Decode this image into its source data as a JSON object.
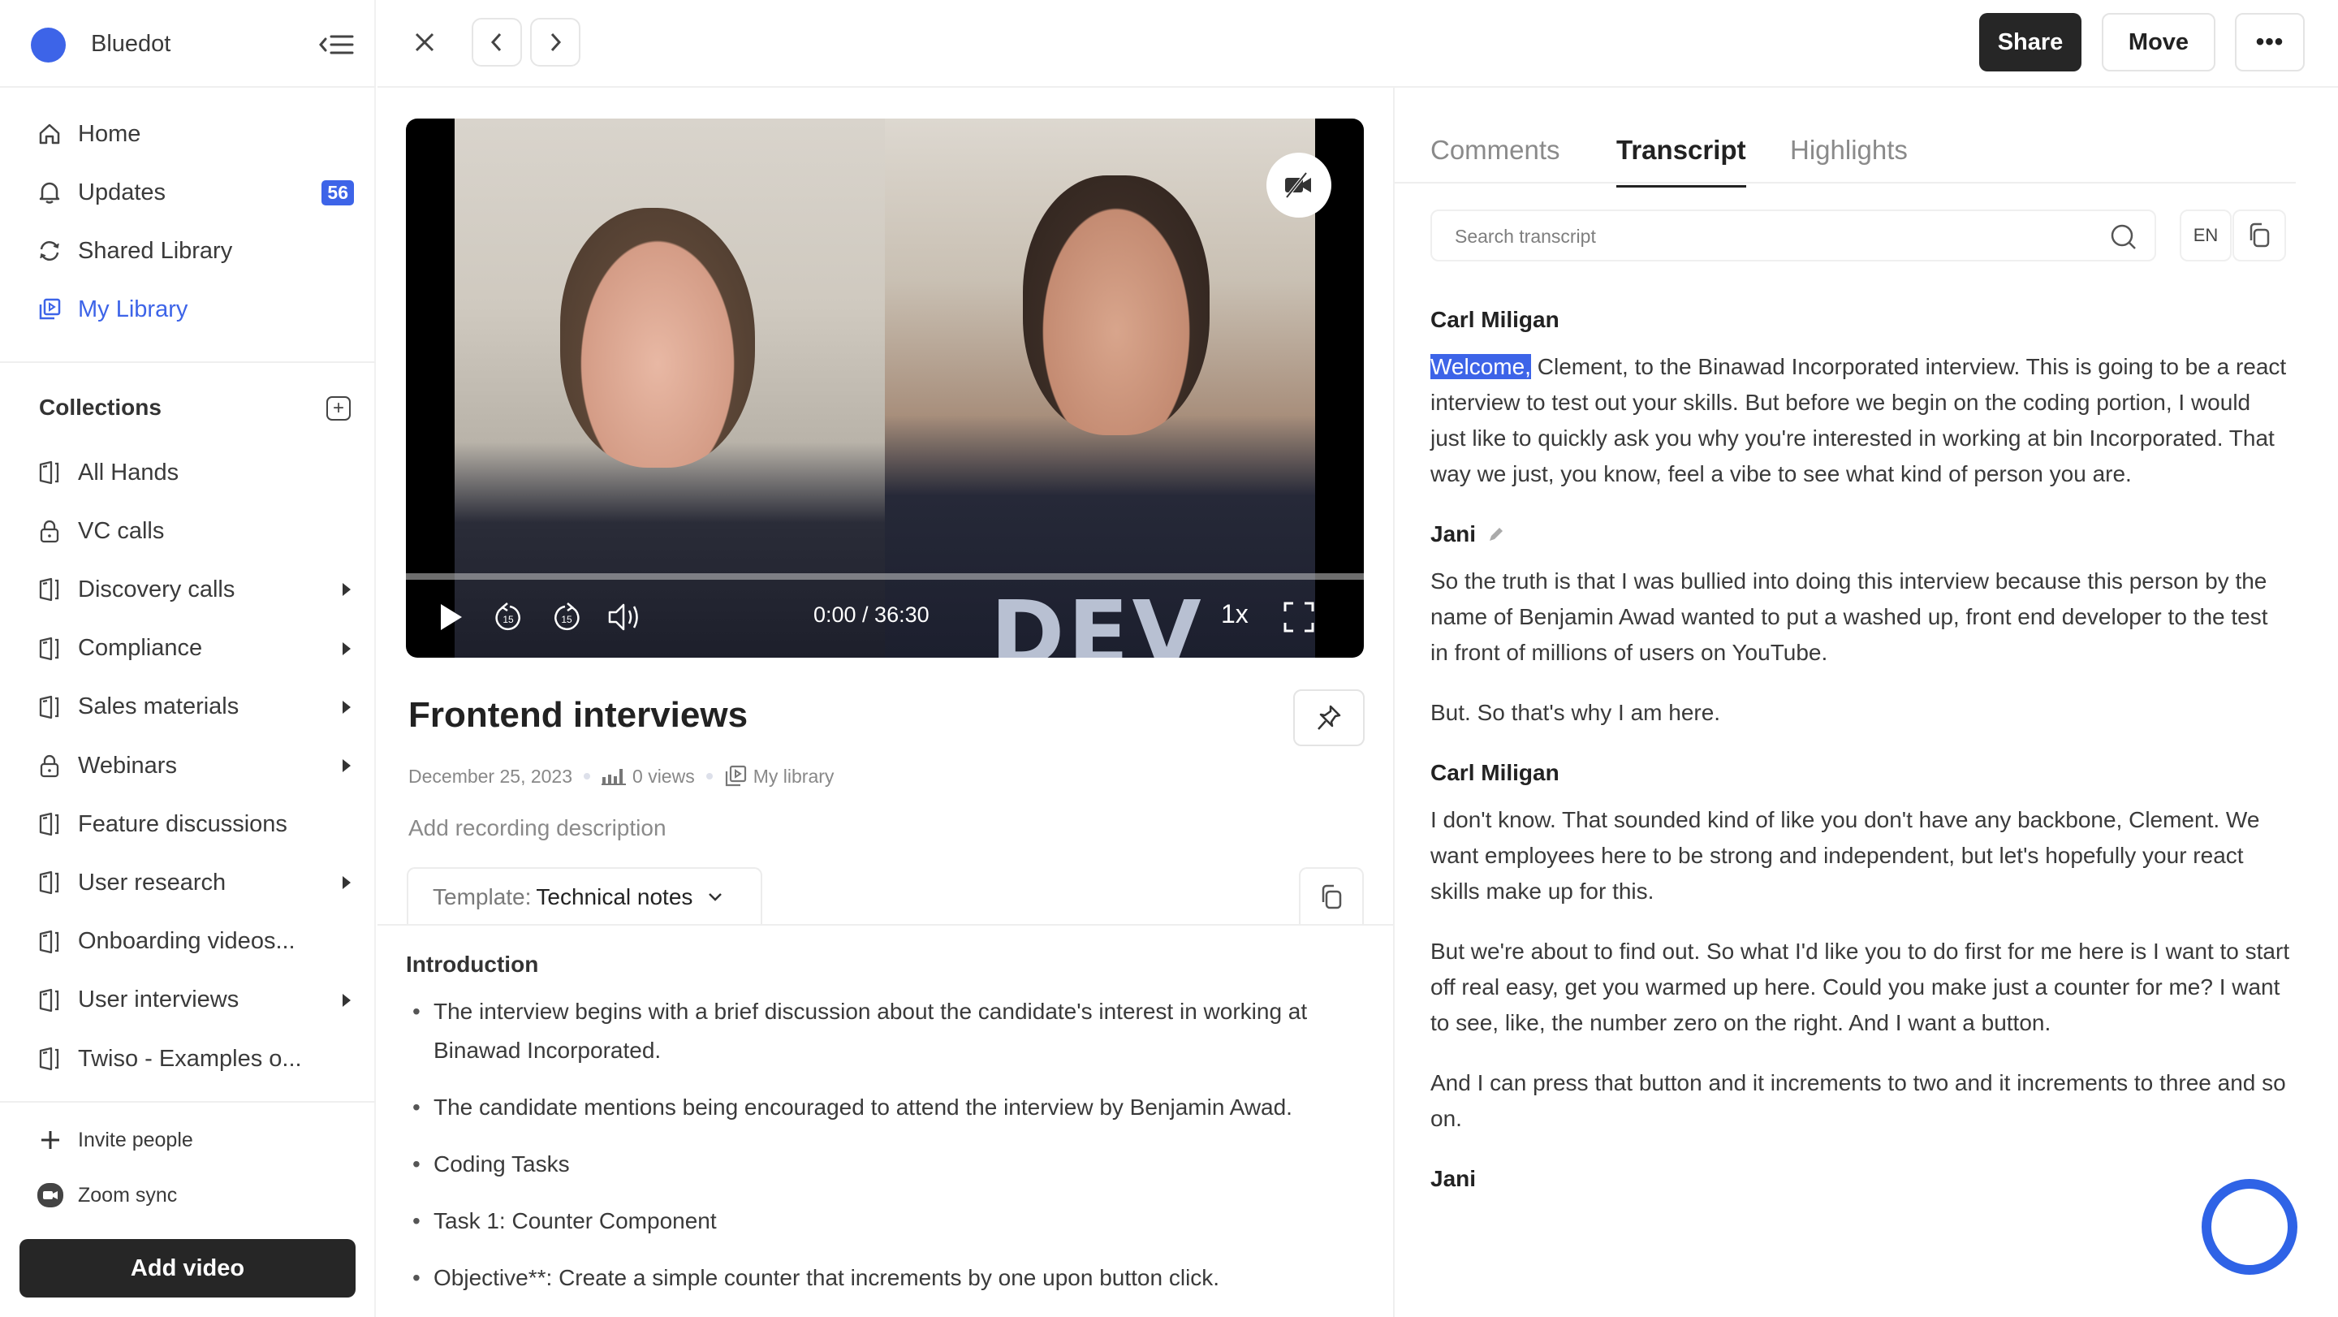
{
  "app": {
    "brand_name": "Bluedot",
    "accent_color": "#3d64e8"
  },
  "sidebar": {
    "nav": [
      {
        "label": "Home",
        "icon": "home-icon"
      },
      {
        "label": "Updates",
        "icon": "bell-icon",
        "badge": "56"
      },
      {
        "label": "Shared Library",
        "icon": "sync-icon"
      },
      {
        "label": "My Library",
        "icon": "library-icon",
        "active": true
      }
    ],
    "collections_title": "Collections",
    "collections": [
      {
        "label": "All Hands",
        "icon": "folder-icon",
        "expandable": false
      },
      {
        "label": "VC calls",
        "icon": "lock-icon",
        "expandable": false
      },
      {
        "label": "Discovery calls",
        "icon": "folder-icon",
        "expandable": true
      },
      {
        "label": "Compliance",
        "icon": "folder-icon",
        "expandable": true
      },
      {
        "label": "Sales materials",
        "icon": "folder-icon",
        "expandable": true
      },
      {
        "label": "Webinars",
        "icon": "lock-icon",
        "expandable": true
      },
      {
        "label": "Feature discussions",
        "icon": "folder-icon",
        "expandable": false
      },
      {
        "label": "User research",
        "icon": "folder-icon",
        "expandable": true
      },
      {
        "label": "Onboarding videos...",
        "icon": "folder-icon",
        "expandable": false
      },
      {
        "label": "User interviews",
        "icon": "folder-icon",
        "expandable": true
      },
      {
        "label": "Twiso - Examples o...",
        "icon": "folder-icon",
        "expandable": false
      }
    ],
    "invite_label": "Invite people",
    "zoom_sync_label": "Zoom sync",
    "add_video_label": "Add video"
  },
  "topbar": {
    "share_label": "Share",
    "move_label": "Move",
    "more_label": "•••"
  },
  "video": {
    "time_display": "0:00 / 36:30",
    "current_time": "0:00",
    "duration": "36:30",
    "progress": 0,
    "speed": "1x",
    "skip_back_seconds": "15",
    "skip_forward_seconds": "15",
    "shirt_text": "DEV"
  },
  "recording": {
    "title": "Frontend interviews",
    "date": "December 25, 2023",
    "views": "0 views",
    "location": "My library",
    "description_placeholder": "Add recording description",
    "template_prefix": "Template:",
    "template_value": "Technical notes"
  },
  "notes": {
    "heading": "Introduction",
    "items": [
      "The interview begins with a brief discussion about the candidate's interest in working at Binawad Incorporated.",
      "The candidate mentions being encouraged to attend the interview by Benjamin Awad.",
      "Coding Tasks",
      "Task 1: Counter Component",
      "Objective**: Create a simple counter that increments by one upon button click."
    ]
  },
  "panel": {
    "tabs": [
      {
        "label": "Comments",
        "active": false
      },
      {
        "label": "Transcript",
        "active": true
      },
      {
        "label": "Highlights",
        "active": false
      }
    ],
    "search_placeholder": "Search transcript",
    "search_value": "",
    "language": "EN"
  },
  "transcript": [
    {
      "speaker": "Carl Miligan",
      "editable": false,
      "paragraphs": [
        {
          "highlight": "Welcome,",
          "text": " Clement, to the Binawad Incorporated interview. This is going to be a react interview to test out your skills. But before we begin on the coding portion, I would just like to quickly ask you why you're interested in working at bin Incorporated. That way we just, you know, feel a vibe to see what kind of person you are."
        }
      ]
    },
    {
      "speaker": "Jani",
      "editable": true,
      "paragraphs": [
        {
          "highlight": "",
          "text": "So the truth is that I was bullied into doing this interview because this person by the name of Benjamin Awad wanted to put a washed up, front end developer to the test in front of millions of users on YouTube."
        },
        {
          "highlight": "",
          "text": "But. So that's why I am here."
        }
      ]
    },
    {
      "speaker": "Carl Miligan",
      "editable": false,
      "paragraphs": [
        {
          "highlight": "",
          "text": "I don't know. That sounded kind of like you don't have any backbone, Clement. We want employees here to be strong and independent, but let's hopefully your react skills make up for this."
        },
        {
          "highlight": "",
          "text": "But we're about to find out. So what I'd like you to do first for me here is I want to start off real easy, get you warmed up here. Could you make just a counter for me? I want to see, like, the number zero on the right. And I want a button."
        },
        {
          "highlight": "",
          "text": "And I can press that button and it increments to two and it increments to three and so on."
        }
      ]
    },
    {
      "speaker": "Jani",
      "editable": false,
      "paragraphs": []
    }
  ]
}
